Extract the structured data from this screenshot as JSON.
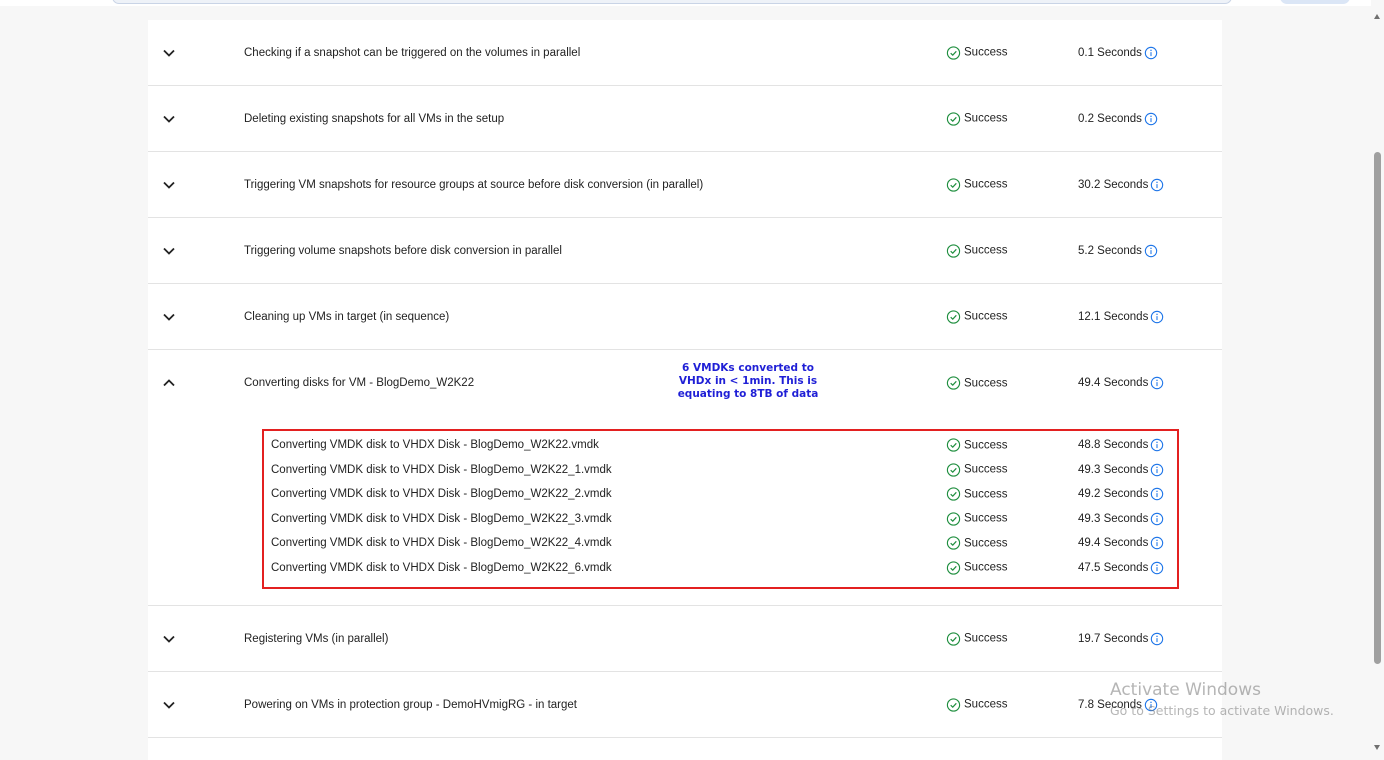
{
  "colors": {
    "success": "#1e8e3e",
    "info": "#1a73e8",
    "annotation": "#1f1fd6",
    "highlight_border": "#e32020"
  },
  "steps": [
    {
      "label": "Checking if a snapshot can be triggered on the volumes in parallel",
      "status": "Success",
      "duration": "0.1 Seconds"
    },
    {
      "label": "Deleting existing snapshots for all VMs in the setup",
      "status": "Success",
      "duration": "0.2 Seconds"
    },
    {
      "label": "Triggering VM snapshots for resource groups at source before disk conversion (in parallel)",
      "status": "Success",
      "duration": "30.2 Seconds"
    },
    {
      "label": "Triggering volume snapshots before disk conversion in parallel",
      "status": "Success",
      "duration": "5.2 Seconds"
    },
    {
      "label": "Cleaning up VMs in target (in sequence)",
      "status": "Success",
      "duration": "12.1 Seconds"
    }
  ],
  "expanded_step": {
    "label": "Converting disks for VM - BlogDemo_W2K22",
    "status": "Success",
    "duration": "49.4 Seconds",
    "annotation": [
      "6 VMDKs converted to",
      "VHDx in < 1min. This is",
      "equating to 8TB of data"
    ],
    "substeps": [
      {
        "label": "Converting VMDK disk to VHDX Disk - BlogDemo_W2K22.vmdk",
        "status": "Success",
        "duration": "48.8 Seconds"
      },
      {
        "label": "Converting VMDK disk to VHDX Disk - BlogDemo_W2K22_1.vmdk",
        "status": "Success",
        "duration": "49.3 Seconds"
      },
      {
        "label": "Converting VMDK disk to VHDX Disk - BlogDemo_W2K22_2.vmdk",
        "status": "Success",
        "duration": "49.2 Seconds"
      },
      {
        "label": "Converting VMDK disk to VHDX Disk - BlogDemo_W2K22_3.vmdk",
        "status": "Success",
        "duration": "49.3 Seconds"
      },
      {
        "label": "Converting VMDK disk to VHDX Disk - BlogDemo_W2K22_4.vmdk",
        "status": "Success",
        "duration": "49.4 Seconds"
      },
      {
        "label": "Converting VMDK disk to VHDX Disk - BlogDemo_W2K22_6.vmdk",
        "status": "Success",
        "duration": "47.5 Seconds"
      }
    ]
  },
  "steps_after": [
    {
      "label": "Registering VMs (in parallel)",
      "status": "Success",
      "duration": "19.7 Seconds"
    },
    {
      "label": "Powering on VMs in protection group - DemoHVmigRG - in target",
      "status": "Success",
      "duration": "7.8 Seconds"
    }
  ],
  "watermark": {
    "title": "Activate Windows",
    "subtitle": "Go to Settings to activate Windows."
  }
}
